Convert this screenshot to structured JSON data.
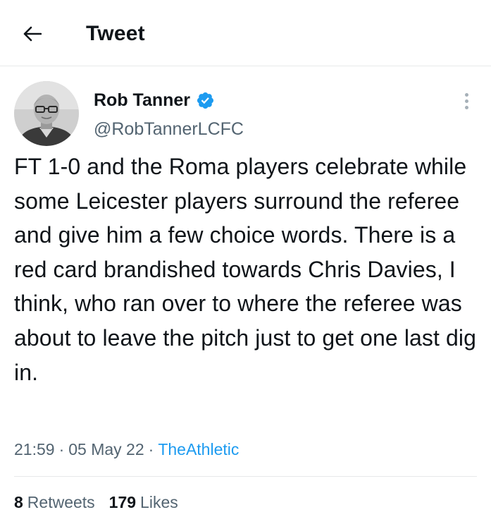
{
  "header": {
    "title": "Tweet"
  },
  "author": {
    "name": "Rob Tanner",
    "handle": "@RobTannerLCFC",
    "verified": true
  },
  "tweet": {
    "text": "FT 1-0 and the Roma players celebrate while some Leicester players surround the referee and give him a few choice words. There is a red card brandished towards Chris Davies, I think, who ran over to where the referee was about to leave the pitch just to get one last dig in.",
    "time": "21:59",
    "date": "05 May 22",
    "source": "TheAthletic",
    "separator": "·"
  },
  "stats": {
    "retweets_count": "8",
    "retweets_label": "Retweets",
    "likes_count": "179",
    "likes_label": "Likes"
  },
  "colors": {
    "accent": "#1d9bf0",
    "secondary_text": "#536471",
    "primary_text": "#0f1419",
    "divider": "#e7e9ea"
  },
  "icons": {
    "back": "arrow-left-icon",
    "verified": "verified-badge-icon",
    "more": "more-vertical-icon"
  }
}
